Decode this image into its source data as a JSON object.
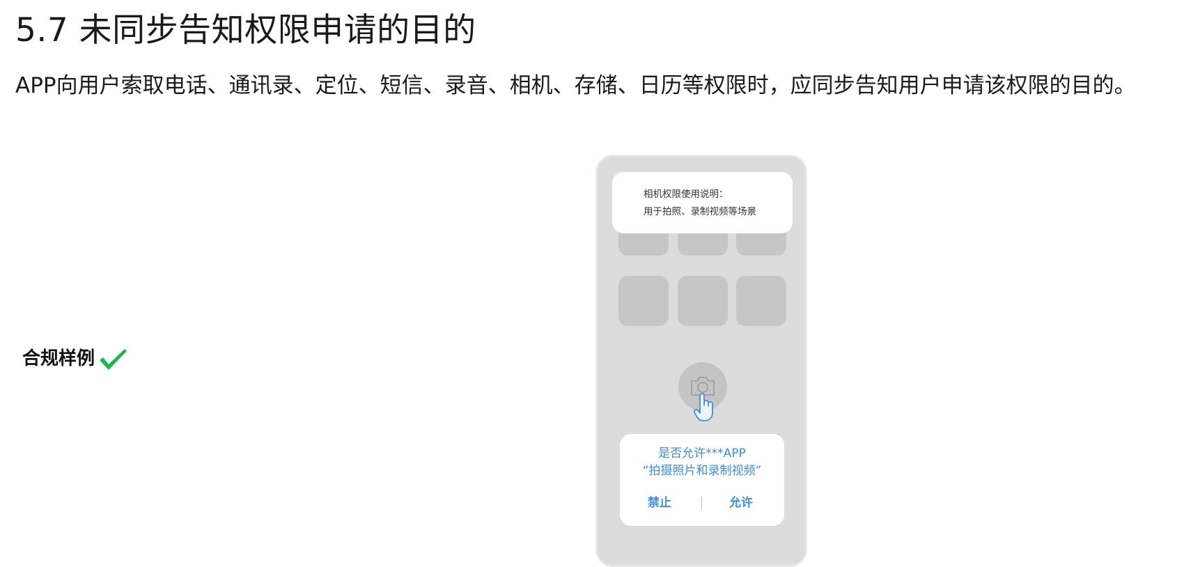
{
  "heading": "5.7 未同步告知权限申请的目的",
  "intro": "APP向用户索取电话、通讯录、定位、短信、录音、相机、存储、日历等权限时，应同步告知用户申请该权限的目的。",
  "example_label": "合规样例",
  "colors": {
    "check": "#1ab84e",
    "dialog_text": "#3c8de0",
    "phone_bg": "#dcdcdc",
    "tile": "#c6c6c6"
  },
  "phone": {
    "info_card": {
      "title": "相机权限使用说明：",
      "desc": "用于拍照、录制视频等场景"
    },
    "permission_dialog": {
      "question": "是否允许***APP",
      "action": "“拍摄照片和录制视频”",
      "deny": "禁止",
      "allow": "允许"
    }
  }
}
